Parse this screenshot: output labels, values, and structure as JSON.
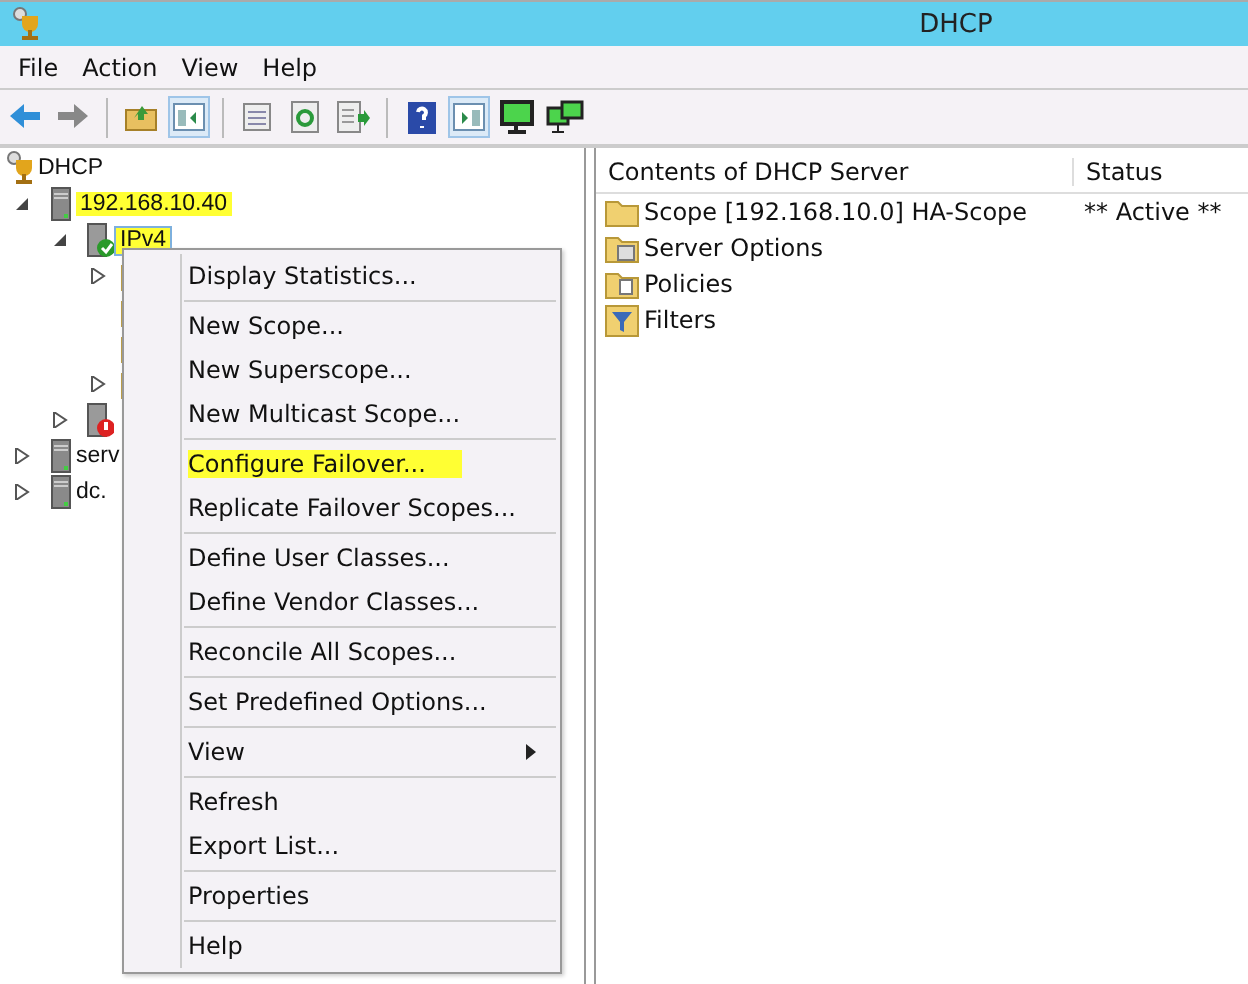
{
  "window": {
    "title": "DHCP"
  },
  "menu_bar": [
    "File",
    "Action",
    "View",
    "Help"
  ],
  "toolbar": [
    {
      "kind": "back"
    },
    {
      "kind": "forward"
    },
    {
      "kind": "sep"
    },
    {
      "kind": "up"
    },
    {
      "kind": "pane",
      "pressed": true
    },
    {
      "kind": "sep"
    },
    {
      "kind": "props"
    },
    {
      "kind": "refresh"
    },
    {
      "kind": "export"
    },
    {
      "kind": "sep"
    },
    {
      "kind": "help"
    },
    {
      "kind": "pane2",
      "pressed": true
    },
    {
      "kind": "monitor"
    },
    {
      "kind": "monitors"
    }
  ],
  "tree": [
    {
      "label": "DHCP",
      "kind": "root",
      "children": [
        {
          "label": "192.168.10.40",
          "kind": "server",
          "expanded": true,
          "highlighted": true,
          "children": [
            {
              "label": "IPv4",
              "kind": "ipv4",
              "expanded": true,
              "highlighted": true,
              "selected": true,
              "children": [
                {
                  "kind": "folder",
                  "expanded": false
                },
                {
                  "kind": "folder"
                },
                {
                  "kind": "folder"
                },
                {
                  "kind": "folder",
                  "expanded": false
                }
              ]
            },
            {
              "kind": "ipv6",
              "expanded": false
            }
          ]
        },
        {
          "label": "serv",
          "kind": "server",
          "expanded": false
        },
        {
          "label": "dc.",
          "kind": "server",
          "expanded": false
        }
      ]
    }
  ],
  "context_menu": [
    [
      {
        "label": "Display Statistics..."
      }
    ],
    [
      {
        "label": "New Scope..."
      },
      {
        "label": "New Superscope..."
      },
      {
        "label": "New Multicast Scope..."
      }
    ],
    [
      {
        "label": "Configure Failover...",
        "highlighted": true
      },
      {
        "label": "Replicate Failover Scopes..."
      }
    ],
    [
      {
        "label": "Define User Classes..."
      },
      {
        "label": "Define Vendor Classes..."
      }
    ],
    [
      {
        "label": "Reconcile All Scopes..."
      }
    ],
    [
      {
        "label": "Set Predefined Options..."
      }
    ],
    [
      {
        "label": "View",
        "submenu": true
      }
    ],
    [
      {
        "label": "Refresh"
      },
      {
        "label": "Export List..."
      }
    ],
    [
      {
        "label": "Properties"
      }
    ],
    [
      {
        "label": "Help"
      }
    ]
  ],
  "list": {
    "columns": [
      "Contents of DHCP Server",
      "Status"
    ],
    "rows": [
      {
        "kind": "scope",
        "name": "Scope [192.168.10.0] HA-Scope",
        "status": "** Active **"
      },
      {
        "kind": "options",
        "name": "Server Options"
      },
      {
        "kind": "policies",
        "name": "Policies"
      },
      {
        "kind": "filters",
        "name": "Filters"
      }
    ]
  }
}
